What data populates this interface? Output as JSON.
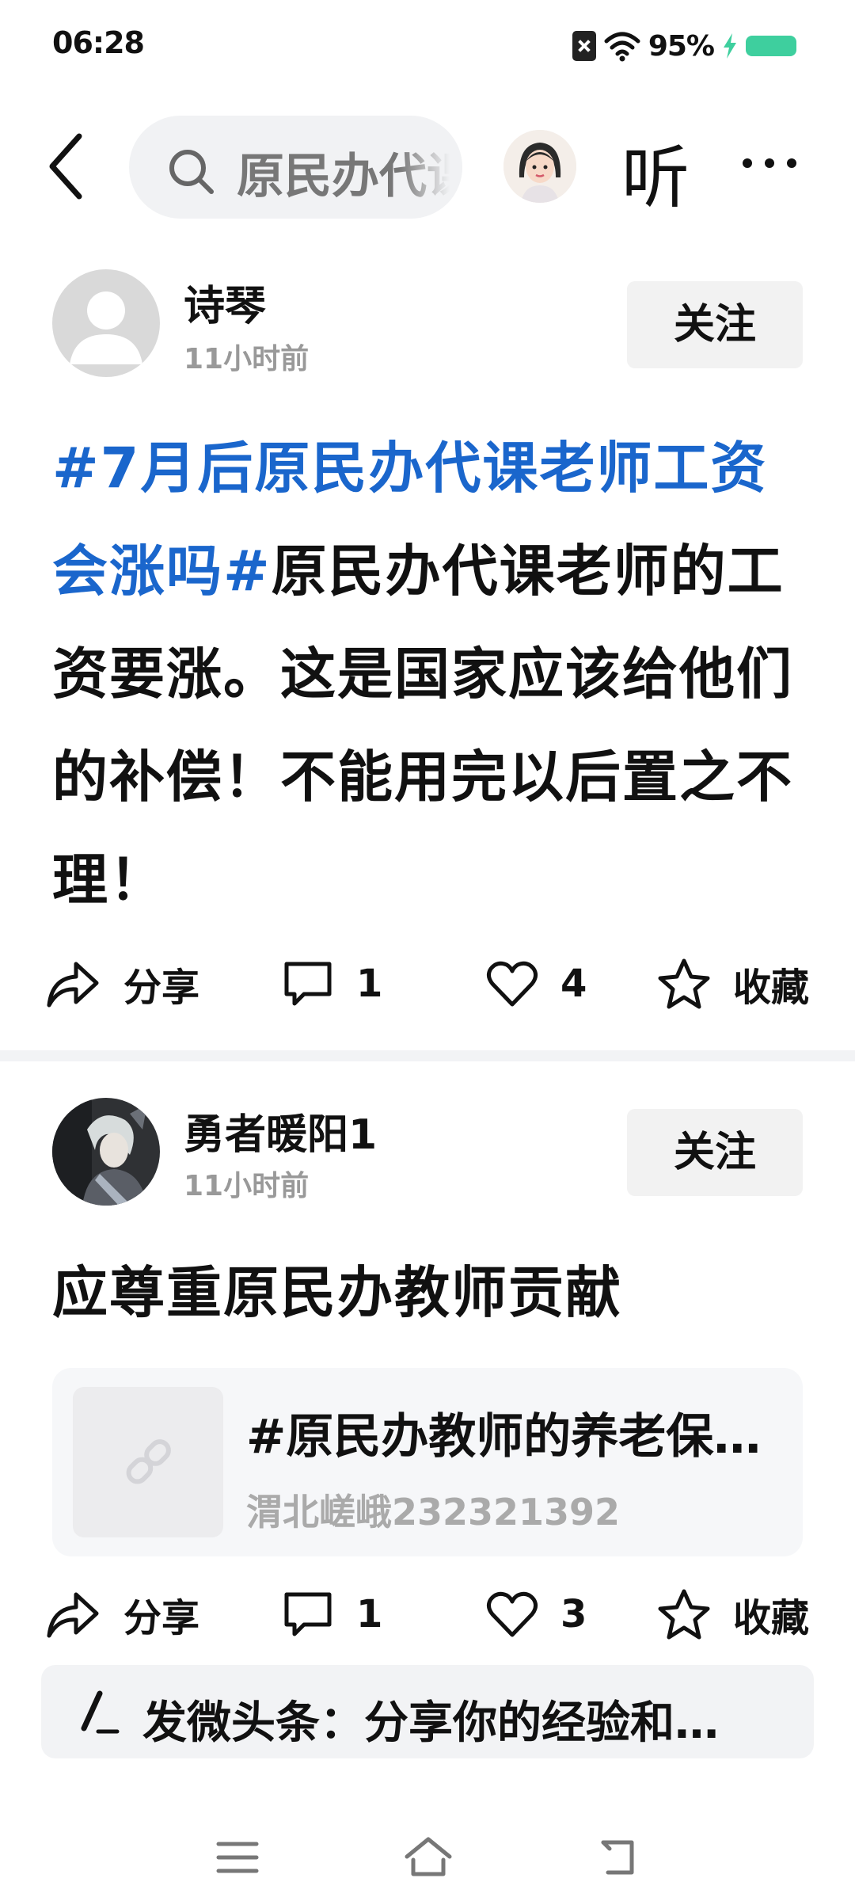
{
  "status_bar": {
    "time": "06:28",
    "battery_percent": "95%",
    "icons": [
      "sim-off-icon",
      "wifi-icon",
      "charging-icon",
      "battery-icon"
    ],
    "battery_color": "#3ecf9e"
  },
  "header": {
    "search_text": "原民办代课老师",
    "listen_label": "听",
    "icons": [
      "back-icon",
      "search-icon",
      "avatar-icon",
      "more-icon"
    ]
  },
  "posts": [
    {
      "author": "诗琴",
      "time": "11小时前",
      "follow_label": "关注",
      "hashtag": "#7月后原民办代课老师工资会涨吗#",
      "body": "原民办代课老师的工资要涨。这是国家应该给他们的补偿！不能用完以后置之不理！",
      "actions": {
        "share": "分享",
        "comments": "1",
        "likes": "4",
        "favorite": "收藏"
      }
    },
    {
      "author": "勇者暖阳1",
      "time": "11小时前",
      "follow_label": "关注",
      "body": "应尊重原民办教师贡献",
      "link_card": {
        "title": "#原民办教师的养老保险问题",
        "source": "渭北嵯峨232321392",
        "icon": "link-icon"
      },
      "actions": {
        "share": "分享",
        "comments": "1",
        "likes": "3",
        "favorite": "收藏"
      }
    }
  ],
  "compose": {
    "placeholder": "发微头条：分享你的经验和…",
    "icon": "pen-icon"
  },
  "nav_bar": {
    "icons": [
      "menu-icon",
      "home-icon",
      "back-nav-icon"
    ]
  },
  "colors": {
    "hashtag": "#1a66cc",
    "follow_bg": "#f2f2f2",
    "muted_text": "#999999"
  }
}
